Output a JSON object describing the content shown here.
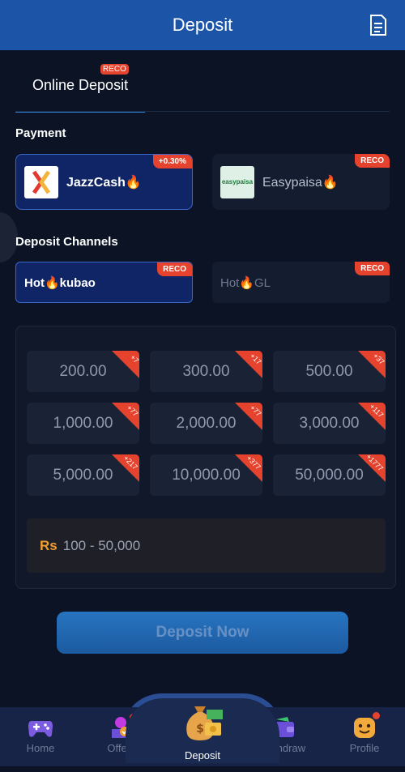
{
  "header": {
    "title": "Deposit",
    "doc_icon": "document-icon"
  },
  "tabs": [
    {
      "label": "Online Deposit",
      "badge": "RECO",
      "active": true
    }
  ],
  "payment": {
    "title": "Payment",
    "methods": [
      {
        "label": "JazzCash🔥",
        "badge": "+0.30%",
        "logo_text": "JazzCash",
        "active": true
      },
      {
        "label": "Easypaisa🔥",
        "badge": "RECO",
        "logo_text": "easypaisa",
        "active": false
      }
    ]
  },
  "channels": {
    "title": "Deposit Channels",
    "items": [
      {
        "label": "Hot🔥kubao",
        "badge": "RECO",
        "active": true
      },
      {
        "label": "Hot🔥GL",
        "badge": "RECO",
        "active": false
      }
    ]
  },
  "amounts": [
    {
      "value": "200.00",
      "bonus": "+7"
    },
    {
      "value": "300.00",
      "bonus": "+17"
    },
    {
      "value": "500.00",
      "bonus": "+37"
    },
    {
      "value": "1,000.00",
      "bonus": "+77"
    },
    {
      "value": "2,000.00",
      "bonus": "+77"
    },
    {
      "value": "3,000.00",
      "bonus": "+117"
    },
    {
      "value": "5,000.00",
      "bonus": "+217"
    },
    {
      "value": "10,000.00",
      "bonus": "+377"
    },
    {
      "value": "50,000.00",
      "bonus": "+1777"
    }
  ],
  "range": {
    "currency": "Rs",
    "value": "100 - 50,000"
  },
  "deposit_button": "Deposit Now",
  "nav": [
    {
      "label": "Home",
      "icon": "gamepad-icon"
    },
    {
      "label": "Offers",
      "icon": "gift-icon"
    },
    {
      "label": "Deposit",
      "icon": "money-bag-icon"
    },
    {
      "label": "Withdraw",
      "icon": "wallet-icon"
    },
    {
      "label": "Profile",
      "icon": "smiley-avatar-icon"
    }
  ],
  "colors": {
    "header": "#1c55a8",
    "accent": "#2f7fd9",
    "badge": "#e5432d",
    "currency": "#f0a030"
  }
}
